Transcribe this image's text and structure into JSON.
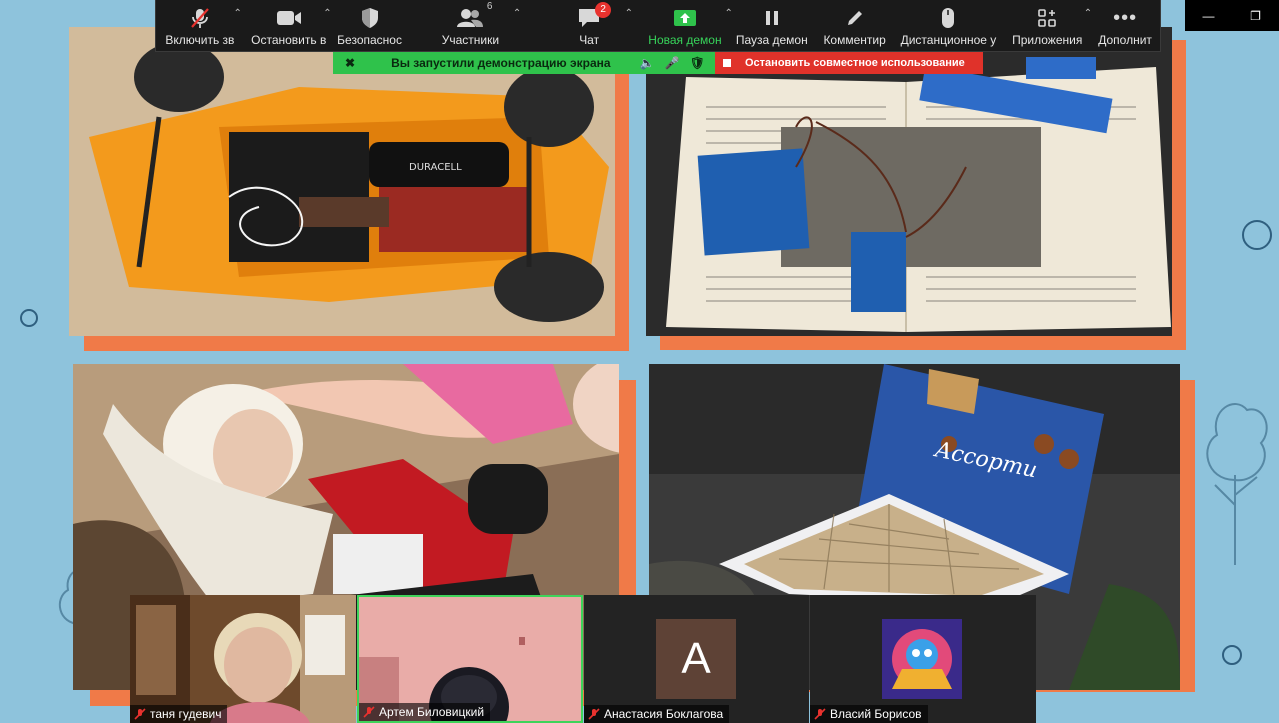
{
  "toolbar": {
    "mute": "Включить зв",
    "video": "Остановить в",
    "security": "Безопаснос",
    "participants": "Участники",
    "participants_count": "6",
    "chat": "Чат",
    "chat_badge": "2",
    "new_share": "Новая демон",
    "pause_share": "Пауза демон",
    "annotate": "Комментир",
    "remote_control": "Дистанционное у",
    "apps": "Приложения",
    "more": "Дополнит"
  },
  "share_bar": {
    "status": "Вы запустили демонстрацию экрана",
    "stop": "Остановить совместное использование"
  },
  "participants": [
    {
      "name": "таня гудевич"
    },
    {
      "name": "Артем Биловицкий"
    },
    {
      "name": "Анастасия Боклагова",
      "initial": "А"
    },
    {
      "name": "Власий Борисов"
    }
  ],
  "shared_photos": {
    "box_text": "Ассорти",
    "battery_label": "DURACELL"
  },
  "colors": {
    "slide_bg": "#8ec3dc",
    "card_accent": "#f07a48",
    "share_green": "#2fc24b",
    "share_red": "#e0322a",
    "toolbar_bg": "#1a1a1a"
  }
}
